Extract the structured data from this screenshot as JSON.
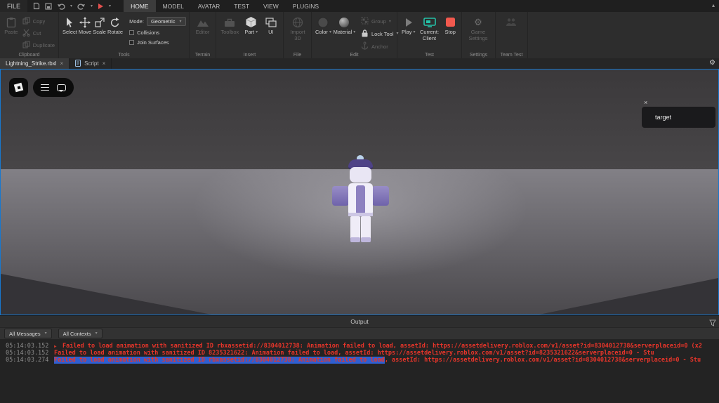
{
  "icons": {
    "caret": "▾",
    "gear": "⚙",
    "close": "×",
    "collapse": "▴"
  },
  "menubar": {
    "file": "FILE",
    "tabs": [
      "HOME",
      "MODEL",
      "AVATAR",
      "TEST",
      "VIEW",
      "PLUGINS"
    ]
  },
  "ribbon": {
    "clipboard": {
      "group": "Clipboard",
      "paste": "Paste",
      "copy": "Copy",
      "cut": "Cut",
      "duplicate": "Duplicate"
    },
    "tools": {
      "group": "Tools",
      "select": "Select",
      "move": "Move",
      "scale": "Scale",
      "rotate": "Rotate",
      "mode_label": "Mode:",
      "mode_value": "Geometric",
      "collisions": "Collisions",
      "join_surfaces": "Join Surfaces"
    },
    "terrain": {
      "group": "Terrain",
      "editor": "Editor"
    },
    "insert": {
      "group": "Insert",
      "toolbox": "Toolbox",
      "part": "Part",
      "ui": "UI"
    },
    "file": {
      "group": "File",
      "import_3d": "Import 3D"
    },
    "edit": {
      "group": "Edit",
      "color": "Color",
      "material": "Material",
      "grp": "Group",
      "lock_tool": "Lock Tool",
      "anchor": "Anchor"
    },
    "test": {
      "group": "Test",
      "play": "Play",
      "current_client": "Current: Client",
      "stop": "Stop"
    },
    "settings": {
      "group": "Settings",
      "game_settings": "Game Settings"
    },
    "team_test": {
      "group": "Team Test"
    }
  },
  "doc_tabs": {
    "tab1": "Lightning_Strike.rbxl",
    "tab2": "Script"
  },
  "viewport": {
    "target_label": "target"
  },
  "output": {
    "title": "Output",
    "filter_messages": "All Messages",
    "filter_contexts": "All Contexts",
    "lines": [
      {
        "time": "05:14:03.152",
        "arrow": "▶",
        "msg": "Failed to load animation with sanitized ID rbxassetid://8304012738: Animation failed to load, assetId: https://assetdelivery.roblox.com/v1/asset?id=8304012738&serverplaceid=0 (x2"
      },
      {
        "time": "05:14:03.152",
        "msg": "Failed to load animation with sanitized ID 8235321622: Animation failed to load, assetId: https://assetdelivery.roblox.com/v1/asset?id=8235321622&serverplaceid=0 - Stu"
      },
      {
        "time": "05:14:03.274",
        "selected": "Failed to load animation with sanitized ID rbxassetid://8304012738: Animation failed to load",
        "msg": ", assetId: https://assetdelivery.roblox.com/v1/asset?id=8304012738&serverplaceid=0 - Stu"
      }
    ]
  },
  "colors": {
    "accent_blue": "#1778cf",
    "error_red": "#e8352a",
    "selection_blue": "#2f5fd0",
    "stop_red": "#f2594e",
    "client_teal": "#25c2a8"
  }
}
